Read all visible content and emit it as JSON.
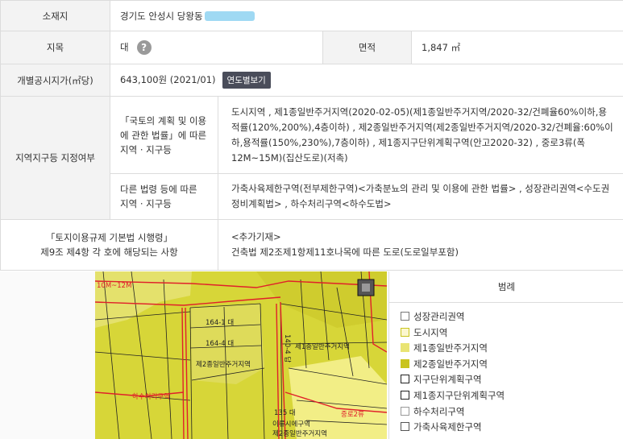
{
  "rows": {
    "location": {
      "label": "소재지",
      "value": "경기도 안성시 당왕동"
    },
    "land_category": {
      "label": "지목",
      "value": "대",
      "help_icon": "question-icon",
      "area_label": "면적",
      "area_value": "1,847 ㎡"
    },
    "official_price": {
      "label": "개별공시지가(㎡당)",
      "value": "643,100원 (2021/01)",
      "button": "연도별보기"
    },
    "zoning": {
      "label": "지역지구등 지정여부",
      "sub1_label": "「국토의 계획 및 이용\n에 관한 법률」에 따른\n지역 · 지구등",
      "sub1_value": "도시지역 , 제1종일반주거지역(2020-02-05)(제1종일반주거지역/2020-32/건폐율60%이하,용적률(120%,200%),4층이하) , 제2종일반주거지역(제2종일반주거지역/2020-32/건폐율:60%이하,용적률(150%,230%),7층이하) , 제1종지구단위계획구역(안고2020-32) , 중로3류(폭 12M~15M)(집산도로)(저촉)",
      "sub2_label": "다른 법령 등에 따른\n지역 · 지구등",
      "sub2_value": "가축사육제한구역(전부제한구역)<가축분뇨의 관리 및 이용에 관한 법률> , 성장관리권역<수도권정비계획법> , 하수처리구역<하수도법>"
    },
    "regulation": {
      "label": "「토지이용규제 기본법 시행령」\n제9조 제4항 각 호에 해당되는 사항",
      "value": "<추가기재>\n건축법 제2조제1항제11호나목에 따른 도로(도로일부포함)"
    }
  },
  "map": {
    "labels": [
      "164-1 대",
      "164-4 대",
      "140-4 답",
      "135 대",
      "제2종일반주거지역",
      "제1종일반주거지역",
      "하수처리구역",
      "이류시에구역",
      "제2종일반주거지역",
      "중로2류",
      "10M~12M"
    ],
    "colors": {
      "yellow": "#d7d638",
      "pale": "#f2ee86",
      "red": "#e0202a",
      "line": "#222222"
    }
  },
  "legend": {
    "title": "범례",
    "items": [
      {
        "label": "성장관리권역",
        "color": "#ffffff"
      },
      {
        "label": "도시지역",
        "color": "#fbf7cf"
      },
      {
        "label": "제1종일반주거지역",
        "color": "#e9e474"
      },
      {
        "label": "제2종일반주거지역",
        "color": "#c9c41e"
      },
      {
        "label": "지구단위계획구역",
        "color": "#ffffff"
      },
      {
        "label": "제1종지구단위계획구역",
        "color": "#ffffff"
      },
      {
        "label": "하수처리구역",
        "color": "#ffffff"
      },
      {
        "label": "가축사육제한구역",
        "color": "#ffffff"
      }
    ]
  }
}
